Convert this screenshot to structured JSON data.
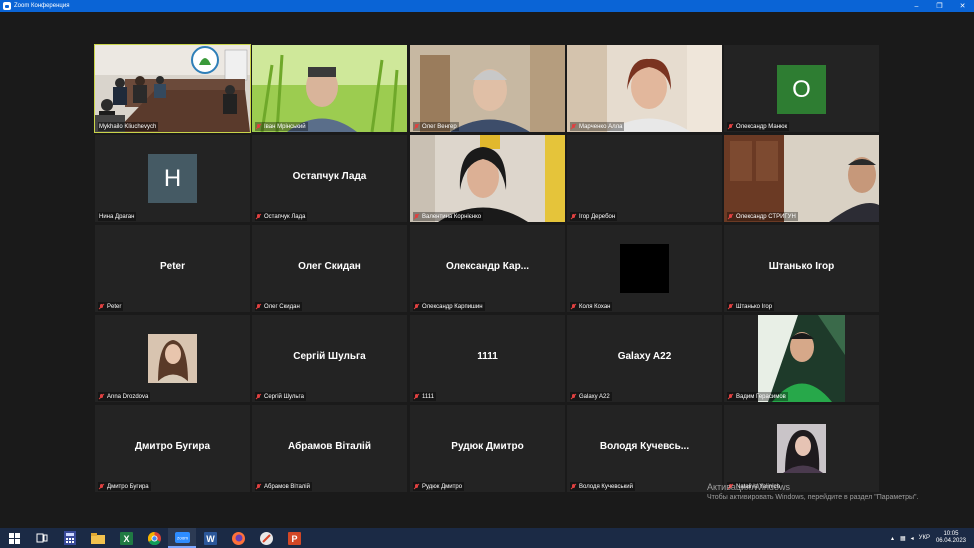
{
  "window": {
    "title": "Zoom Конференция"
  },
  "controls": {
    "minimize": "–",
    "maximize": "❐",
    "close": "✕"
  },
  "tiles": [
    {
      "label": "Mykhailo   Kliuchevych",
      "muted": false
    },
    {
      "label": "Іван Мрінський",
      "muted": true
    },
    {
      "label": "Олег Венгер",
      "muted": true
    },
    {
      "label": "Марченко Алла",
      "muted": true
    },
    {
      "label": "Олександр Манюк",
      "muted": true,
      "avatar_letter": "О",
      "avatar_color": "#2e7d32"
    },
    {
      "label": "Нина Драган",
      "muted": false,
      "avatar_letter": "Н",
      "avatar_color": "#455a64"
    },
    {
      "label": "Остапчук Лада",
      "muted": true,
      "display_name": "Остапчук Лада"
    },
    {
      "label": "Валентина Корнієнко",
      "muted": true
    },
    {
      "label": "Ігор Деребон",
      "muted": true
    },
    {
      "label": "Олександр СТРИГУН",
      "muted": true
    },
    {
      "label": "Peter",
      "muted": true,
      "display_name": "Peter"
    },
    {
      "label": "Олег Скидан",
      "muted": true,
      "display_name": "Олег Скидан"
    },
    {
      "label": "Олександр Карпишин",
      "muted": true,
      "display_name": "Олександр Кар..."
    },
    {
      "label": "Коля Кохан",
      "muted": true
    },
    {
      "label": "Штанько Ігор",
      "muted": true,
      "display_name": "Штанько Ігор"
    },
    {
      "label": "Anna Drozdova",
      "muted": true
    },
    {
      "label": "Сергій Шульга",
      "muted": true,
      "display_name": "Сергій Шульга"
    },
    {
      "label": "1111",
      "muted": true,
      "display_name": "1111"
    },
    {
      "label": "Galaxy A22",
      "muted": true,
      "display_name": "Galaxy A22"
    },
    {
      "label": "Вадим Герасимов",
      "muted": true
    },
    {
      "label": "Дмитро Бугира",
      "muted": true,
      "display_name": "Дмитро Бугира"
    },
    {
      "label": "Абрамов Віталій",
      "muted": true,
      "display_name": "Абрамов Віталій"
    },
    {
      "label": "Рудюк Дмитро",
      "muted": true,
      "display_name": "Рудюк Дмитро"
    },
    {
      "label": "Володя Кучевський",
      "muted": true,
      "display_name": "Володя  Кучевсь..."
    },
    {
      "label": "Nataliya Yalinich",
      "muted": true
    }
  ],
  "watermark": {
    "line1": "Активация Windows",
    "line2": "Чтобы активировать Windows, перейдите в раздел \"Параметры\"."
  },
  "taskbar": {
    "apps": [
      "start-icon",
      "task-view-icon",
      "calculator-icon",
      "file-explorer-icon",
      "excel-icon",
      "chrome-icon",
      "zoom-icon",
      "word-icon",
      "firefox-icon",
      "app-icon",
      "powerpoint-icon"
    ],
    "zoom_label": "zoom",
    "word_label": "W",
    "excel_label": "X",
    "ppt_label": "P",
    "lang": "УКР",
    "time": "10:05",
    "date": "06.04.2023"
  }
}
